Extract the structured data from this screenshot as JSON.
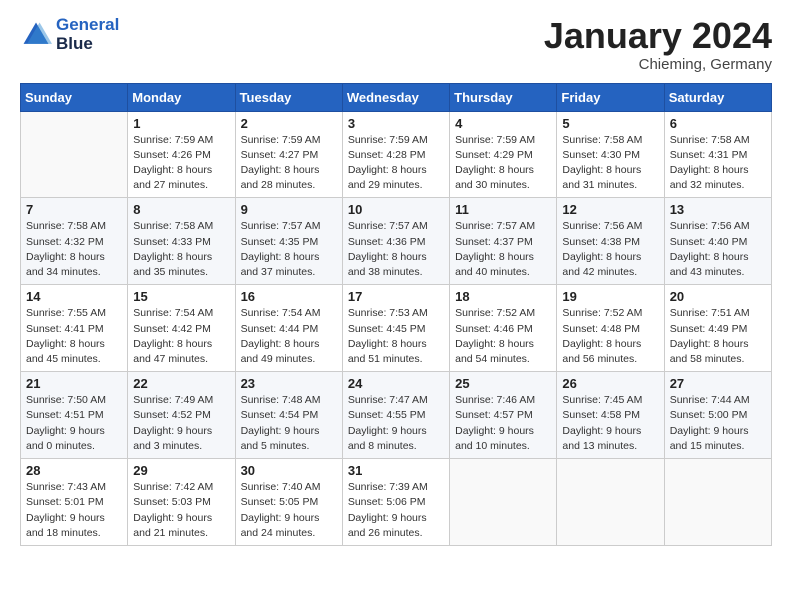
{
  "header": {
    "logo_line1": "General",
    "logo_line2": "Blue",
    "calendar_title": "January 2024",
    "calendar_subtitle": "Chieming, Germany"
  },
  "columns": [
    "Sunday",
    "Monday",
    "Tuesday",
    "Wednesday",
    "Thursday",
    "Friday",
    "Saturday"
  ],
  "weeks": [
    [
      {
        "day": "",
        "info": ""
      },
      {
        "day": "1",
        "info": "Sunrise: 7:59 AM\nSunset: 4:26 PM\nDaylight: 8 hours\nand 27 minutes."
      },
      {
        "day": "2",
        "info": "Sunrise: 7:59 AM\nSunset: 4:27 PM\nDaylight: 8 hours\nand 28 minutes."
      },
      {
        "day": "3",
        "info": "Sunrise: 7:59 AM\nSunset: 4:28 PM\nDaylight: 8 hours\nand 29 minutes."
      },
      {
        "day": "4",
        "info": "Sunrise: 7:59 AM\nSunset: 4:29 PM\nDaylight: 8 hours\nand 30 minutes."
      },
      {
        "day": "5",
        "info": "Sunrise: 7:58 AM\nSunset: 4:30 PM\nDaylight: 8 hours\nand 31 minutes."
      },
      {
        "day": "6",
        "info": "Sunrise: 7:58 AM\nSunset: 4:31 PM\nDaylight: 8 hours\nand 32 minutes."
      }
    ],
    [
      {
        "day": "7",
        "info": "Sunrise: 7:58 AM\nSunset: 4:32 PM\nDaylight: 8 hours\nand 34 minutes."
      },
      {
        "day": "8",
        "info": "Sunrise: 7:58 AM\nSunset: 4:33 PM\nDaylight: 8 hours\nand 35 minutes."
      },
      {
        "day": "9",
        "info": "Sunrise: 7:57 AM\nSunset: 4:35 PM\nDaylight: 8 hours\nand 37 minutes."
      },
      {
        "day": "10",
        "info": "Sunrise: 7:57 AM\nSunset: 4:36 PM\nDaylight: 8 hours\nand 38 minutes."
      },
      {
        "day": "11",
        "info": "Sunrise: 7:57 AM\nSunset: 4:37 PM\nDaylight: 8 hours\nand 40 minutes."
      },
      {
        "day": "12",
        "info": "Sunrise: 7:56 AM\nSunset: 4:38 PM\nDaylight: 8 hours\nand 42 minutes."
      },
      {
        "day": "13",
        "info": "Sunrise: 7:56 AM\nSunset: 4:40 PM\nDaylight: 8 hours\nand 43 minutes."
      }
    ],
    [
      {
        "day": "14",
        "info": "Sunrise: 7:55 AM\nSunset: 4:41 PM\nDaylight: 8 hours\nand 45 minutes."
      },
      {
        "day": "15",
        "info": "Sunrise: 7:54 AM\nSunset: 4:42 PM\nDaylight: 8 hours\nand 47 minutes."
      },
      {
        "day": "16",
        "info": "Sunrise: 7:54 AM\nSunset: 4:44 PM\nDaylight: 8 hours\nand 49 minutes."
      },
      {
        "day": "17",
        "info": "Sunrise: 7:53 AM\nSunset: 4:45 PM\nDaylight: 8 hours\nand 51 minutes."
      },
      {
        "day": "18",
        "info": "Sunrise: 7:52 AM\nSunset: 4:46 PM\nDaylight: 8 hours\nand 54 minutes."
      },
      {
        "day": "19",
        "info": "Sunrise: 7:52 AM\nSunset: 4:48 PM\nDaylight: 8 hours\nand 56 minutes."
      },
      {
        "day": "20",
        "info": "Sunrise: 7:51 AM\nSunset: 4:49 PM\nDaylight: 8 hours\nand 58 minutes."
      }
    ],
    [
      {
        "day": "21",
        "info": "Sunrise: 7:50 AM\nSunset: 4:51 PM\nDaylight: 9 hours\nand 0 minutes."
      },
      {
        "day": "22",
        "info": "Sunrise: 7:49 AM\nSunset: 4:52 PM\nDaylight: 9 hours\nand 3 minutes."
      },
      {
        "day": "23",
        "info": "Sunrise: 7:48 AM\nSunset: 4:54 PM\nDaylight: 9 hours\nand 5 minutes."
      },
      {
        "day": "24",
        "info": "Sunrise: 7:47 AM\nSunset: 4:55 PM\nDaylight: 9 hours\nand 8 minutes."
      },
      {
        "day": "25",
        "info": "Sunrise: 7:46 AM\nSunset: 4:57 PM\nDaylight: 9 hours\nand 10 minutes."
      },
      {
        "day": "26",
        "info": "Sunrise: 7:45 AM\nSunset: 4:58 PM\nDaylight: 9 hours\nand 13 minutes."
      },
      {
        "day": "27",
        "info": "Sunrise: 7:44 AM\nSunset: 5:00 PM\nDaylight: 9 hours\nand 15 minutes."
      }
    ],
    [
      {
        "day": "28",
        "info": "Sunrise: 7:43 AM\nSunset: 5:01 PM\nDaylight: 9 hours\nand 18 minutes."
      },
      {
        "day": "29",
        "info": "Sunrise: 7:42 AM\nSunset: 5:03 PM\nDaylight: 9 hours\nand 21 minutes."
      },
      {
        "day": "30",
        "info": "Sunrise: 7:40 AM\nSunset: 5:05 PM\nDaylight: 9 hours\nand 24 minutes."
      },
      {
        "day": "31",
        "info": "Sunrise: 7:39 AM\nSunset: 5:06 PM\nDaylight: 9 hours\nand 26 minutes."
      },
      {
        "day": "",
        "info": ""
      },
      {
        "day": "",
        "info": ""
      },
      {
        "day": "",
        "info": ""
      }
    ]
  ]
}
